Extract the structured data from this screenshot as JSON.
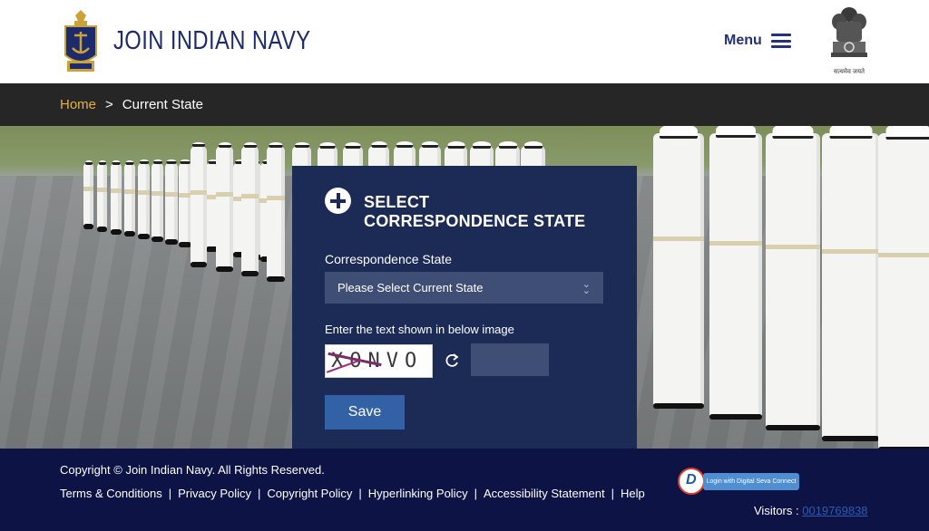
{
  "header": {
    "site_title": "JOIN INDIAN NAVY",
    "menu_label": "Menu",
    "emblem_caption": "सत्यमेव जयते"
  },
  "breadcrumb": {
    "home": "Home",
    "separator": ">",
    "current": "Current State"
  },
  "form": {
    "title_line1": "SELECT",
    "title_line2": "CORRESPONDENCE STATE",
    "state_label": "Correspondence State",
    "state_selected": "Please Select Current State",
    "captcha_label": "Enter the text shown in below image",
    "captcha_text": "XONVO",
    "captcha_value": "",
    "save_label": "Save"
  },
  "footer": {
    "copyright": "Copyright © Join Indian Navy. All Rights Reserved.",
    "links": [
      "Terms & Conditions",
      "Privacy Policy",
      "Copyright Policy",
      "Hyperlinking Policy",
      "Accessibility Statement",
      "Help"
    ],
    "digital_seva_label": "Login with Digital Seva Connect",
    "visitors_label": "Visitors :",
    "visitors_count": "0019769838"
  },
  "colors": {
    "navy": "#1d2a6b",
    "breadcrumb_bg": "#262626",
    "home_link": "#e6b13d",
    "card_bg": "#1c2a56",
    "save_button": "#3361a5",
    "footer_bg": "#0d1445"
  },
  "icons": {
    "logo": "navy-crest-icon",
    "menu": "hamburger-icon",
    "emblem": "national-emblem-icon",
    "card": "plus-circle-icon",
    "select": "chevron-down-icon",
    "refresh": "refresh-icon"
  }
}
